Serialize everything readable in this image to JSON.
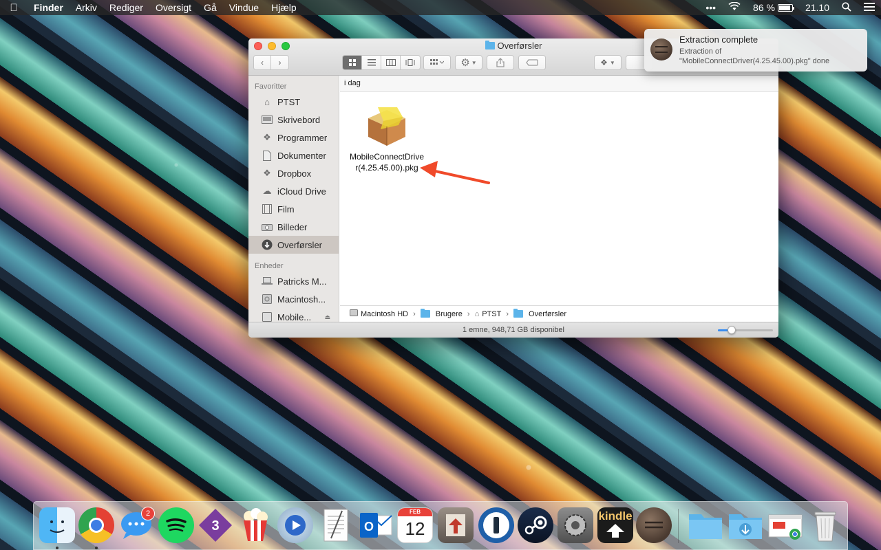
{
  "menubar": {
    "app_name": "Finder",
    "menus": [
      "Arkiv",
      "Rediger",
      "Oversigt",
      "Gå",
      "Vindue",
      "Hjælp"
    ],
    "battery": "86 %",
    "clock": "21.10"
  },
  "window": {
    "title": "Overførsler",
    "sidebar": {
      "favorites_header": "Favoritter",
      "favorites": [
        {
          "label": "PTST",
          "icon": "home-icon"
        },
        {
          "label": "Skrivebord",
          "icon": "desktop-icon"
        },
        {
          "label": "Programmer",
          "icon": "applications-icon"
        },
        {
          "label": "Dokumenter",
          "icon": "documents-icon"
        },
        {
          "label": "Dropbox",
          "icon": "dropbox-icon"
        },
        {
          "label": "iCloud Drive",
          "icon": "cloud-icon"
        },
        {
          "label": "Film",
          "icon": "film-icon"
        },
        {
          "label": "Billeder",
          "icon": "camera-icon"
        },
        {
          "label": "Overførsler",
          "icon": "download-icon",
          "selected": true
        }
      ],
      "devices_header": "Enheder",
      "devices": [
        {
          "label": "Patricks M...",
          "icon": "laptop-icon"
        },
        {
          "label": "Macintosh...",
          "icon": "hard-drive-icon"
        },
        {
          "label": "Mobile...",
          "icon": "disk-icon",
          "ejectable": true
        }
      ]
    },
    "group_header": "i dag",
    "files": [
      {
        "name": "MobileConnectDriver(4.25.45.00).pkg",
        "icon": "package-icon"
      }
    ],
    "pathbar": [
      "Macintosh HD",
      "Brugere",
      "PTST",
      "Overførsler"
    ],
    "status": "1 emne, 948,71 GB disponibel",
    "icon_size_slider": 0.25
  },
  "notification": {
    "title": "Extraction complete",
    "body_line1": "Extraction of",
    "body_line2": "\"MobileConnectDriver(4.25.45.00).pkg\" done"
  },
  "dock": {
    "apps": [
      {
        "name": "Finder",
        "icon": "finder-icon",
        "running": true
      },
      {
        "name": "Chrome",
        "icon": "chrome-icon",
        "running": true
      },
      {
        "name": "Messages",
        "icon": "messages-icon",
        "badge": "2"
      },
      {
        "name": "Spotify",
        "icon": "spotify-icon"
      },
      {
        "name": "Sublime",
        "icon": "sublime-icon",
        "label": "3"
      },
      {
        "name": "Popcorn",
        "icon": "popcorn-icon"
      },
      {
        "name": "QuickTime",
        "icon": "quicktime-icon"
      },
      {
        "name": "TextEdit",
        "icon": "textedit-icon"
      },
      {
        "name": "Outlook",
        "icon": "outlook-icon"
      },
      {
        "name": "Calendar",
        "icon": "calendar-icon",
        "month": "FEB",
        "day": "12"
      },
      {
        "name": "Installer",
        "icon": "installer-icon"
      },
      {
        "name": "1Password",
        "icon": "onepassword-icon"
      },
      {
        "name": "Steam",
        "icon": "steam-icon"
      },
      {
        "name": "System Preferences",
        "icon": "settings-icon"
      },
      {
        "name": "Kindle",
        "icon": "kindle-icon",
        "label": "kindle"
      },
      {
        "name": "Archive Utility",
        "icon": "archive-icon"
      },
      {
        "name": "Documents",
        "icon": "folder-icon"
      },
      {
        "name": "Downloads",
        "icon": "downloads-folder-icon"
      },
      {
        "name": "Chrome Window",
        "icon": "chrome-window-icon"
      },
      {
        "name": "Trash",
        "icon": "trash-icon"
      }
    ]
  }
}
